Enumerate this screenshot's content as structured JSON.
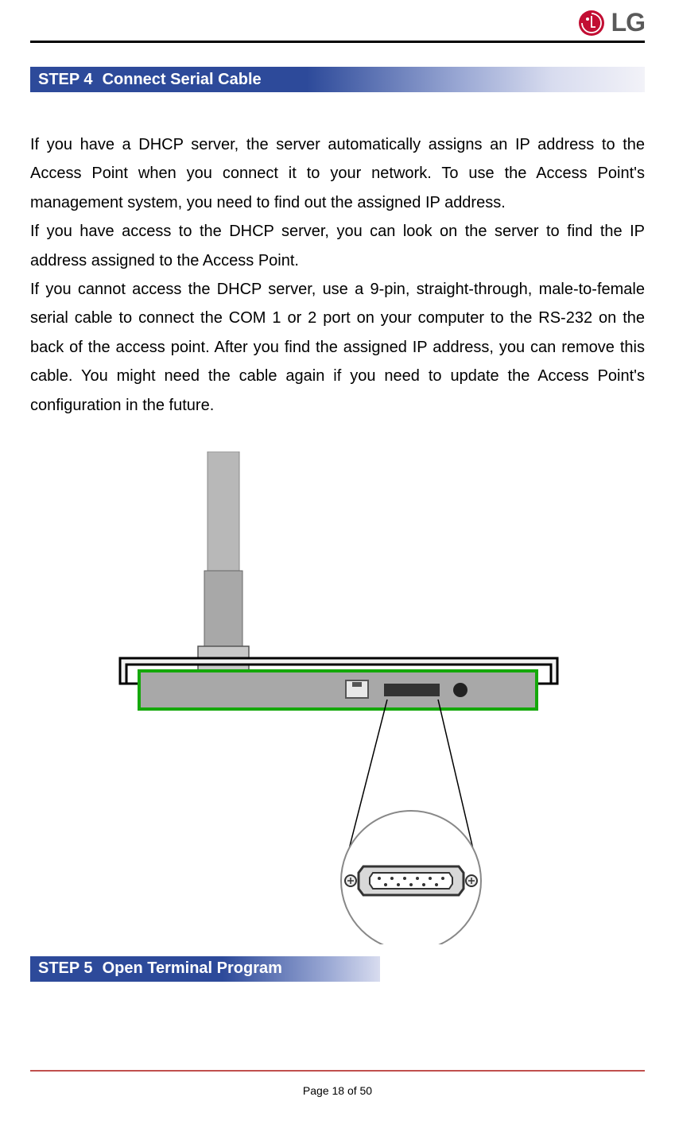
{
  "brand": "LG",
  "step4": {
    "prefix": "STEP 4",
    "title": "Connect Serial Cable"
  },
  "step5": {
    "prefix": "STEP 5",
    "title": "Open Terminal Program"
  },
  "paragraph1": "If you have a DHCP server, the server automatically assigns an IP address to the Access Point when you connect it to your network. To use the Access Point's management system, you need to find out the assigned IP address.",
  "paragraph2": "If you have access to the DHCP server, you can look on the server to find the IP address assigned to the Access Point.",
  "paragraph3": "If you cannot access the DHCP server, use a 9-pin, straight-through, male-to-female serial cable to connect the COM 1 or 2 port on your computer to the RS-232 on the back of the access point. After you find the assigned IP address, you can remove this cable. You might need the cable again if you need to update the Access Point's configuration in the future.",
  "pagination": "Page 18 of 50"
}
